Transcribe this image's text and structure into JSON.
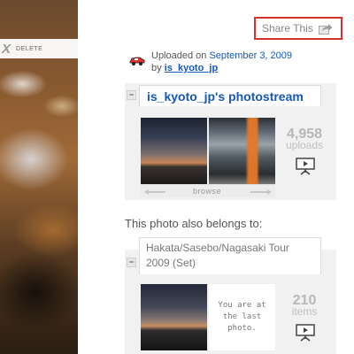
{
  "photo": {
    "delete_label": "DELETE",
    "delete_glyph": "X"
  },
  "share": {
    "label": "Share This",
    "icon": "share-arrow-icon",
    "border_color": "#d0302f"
  },
  "uploader": {
    "uploaded_prefix": "Uploaded on",
    "date": "September 3, 2009",
    "by_prefix": "by",
    "username": "is_kyoto_jp",
    "icon": "buddy-icon",
    "link_color": "#1757b5"
  },
  "photostream": {
    "collapse_glyph": "−",
    "title": "is_kyoto_jp's photostream",
    "count": "4,958",
    "count_label": "uploads",
    "slideshow_icon": "slideshow-icon",
    "nav_label": "browse",
    "prev_icon": "arrow-left-icon",
    "next_icon": "arrow-right-icon"
  },
  "belongs": {
    "text": "This photo also belongs to:"
  },
  "set": {
    "collapse_glyph": "−",
    "title_line1": "Hakata/Sasebo/Nagasaki Tour",
    "title_line2": "2009 (Set)",
    "last_line1": "You are at",
    "last_line2": "the last",
    "last_line3": "photo.",
    "count": "210",
    "count_label": "items",
    "slideshow_icon": "slideshow-icon"
  }
}
